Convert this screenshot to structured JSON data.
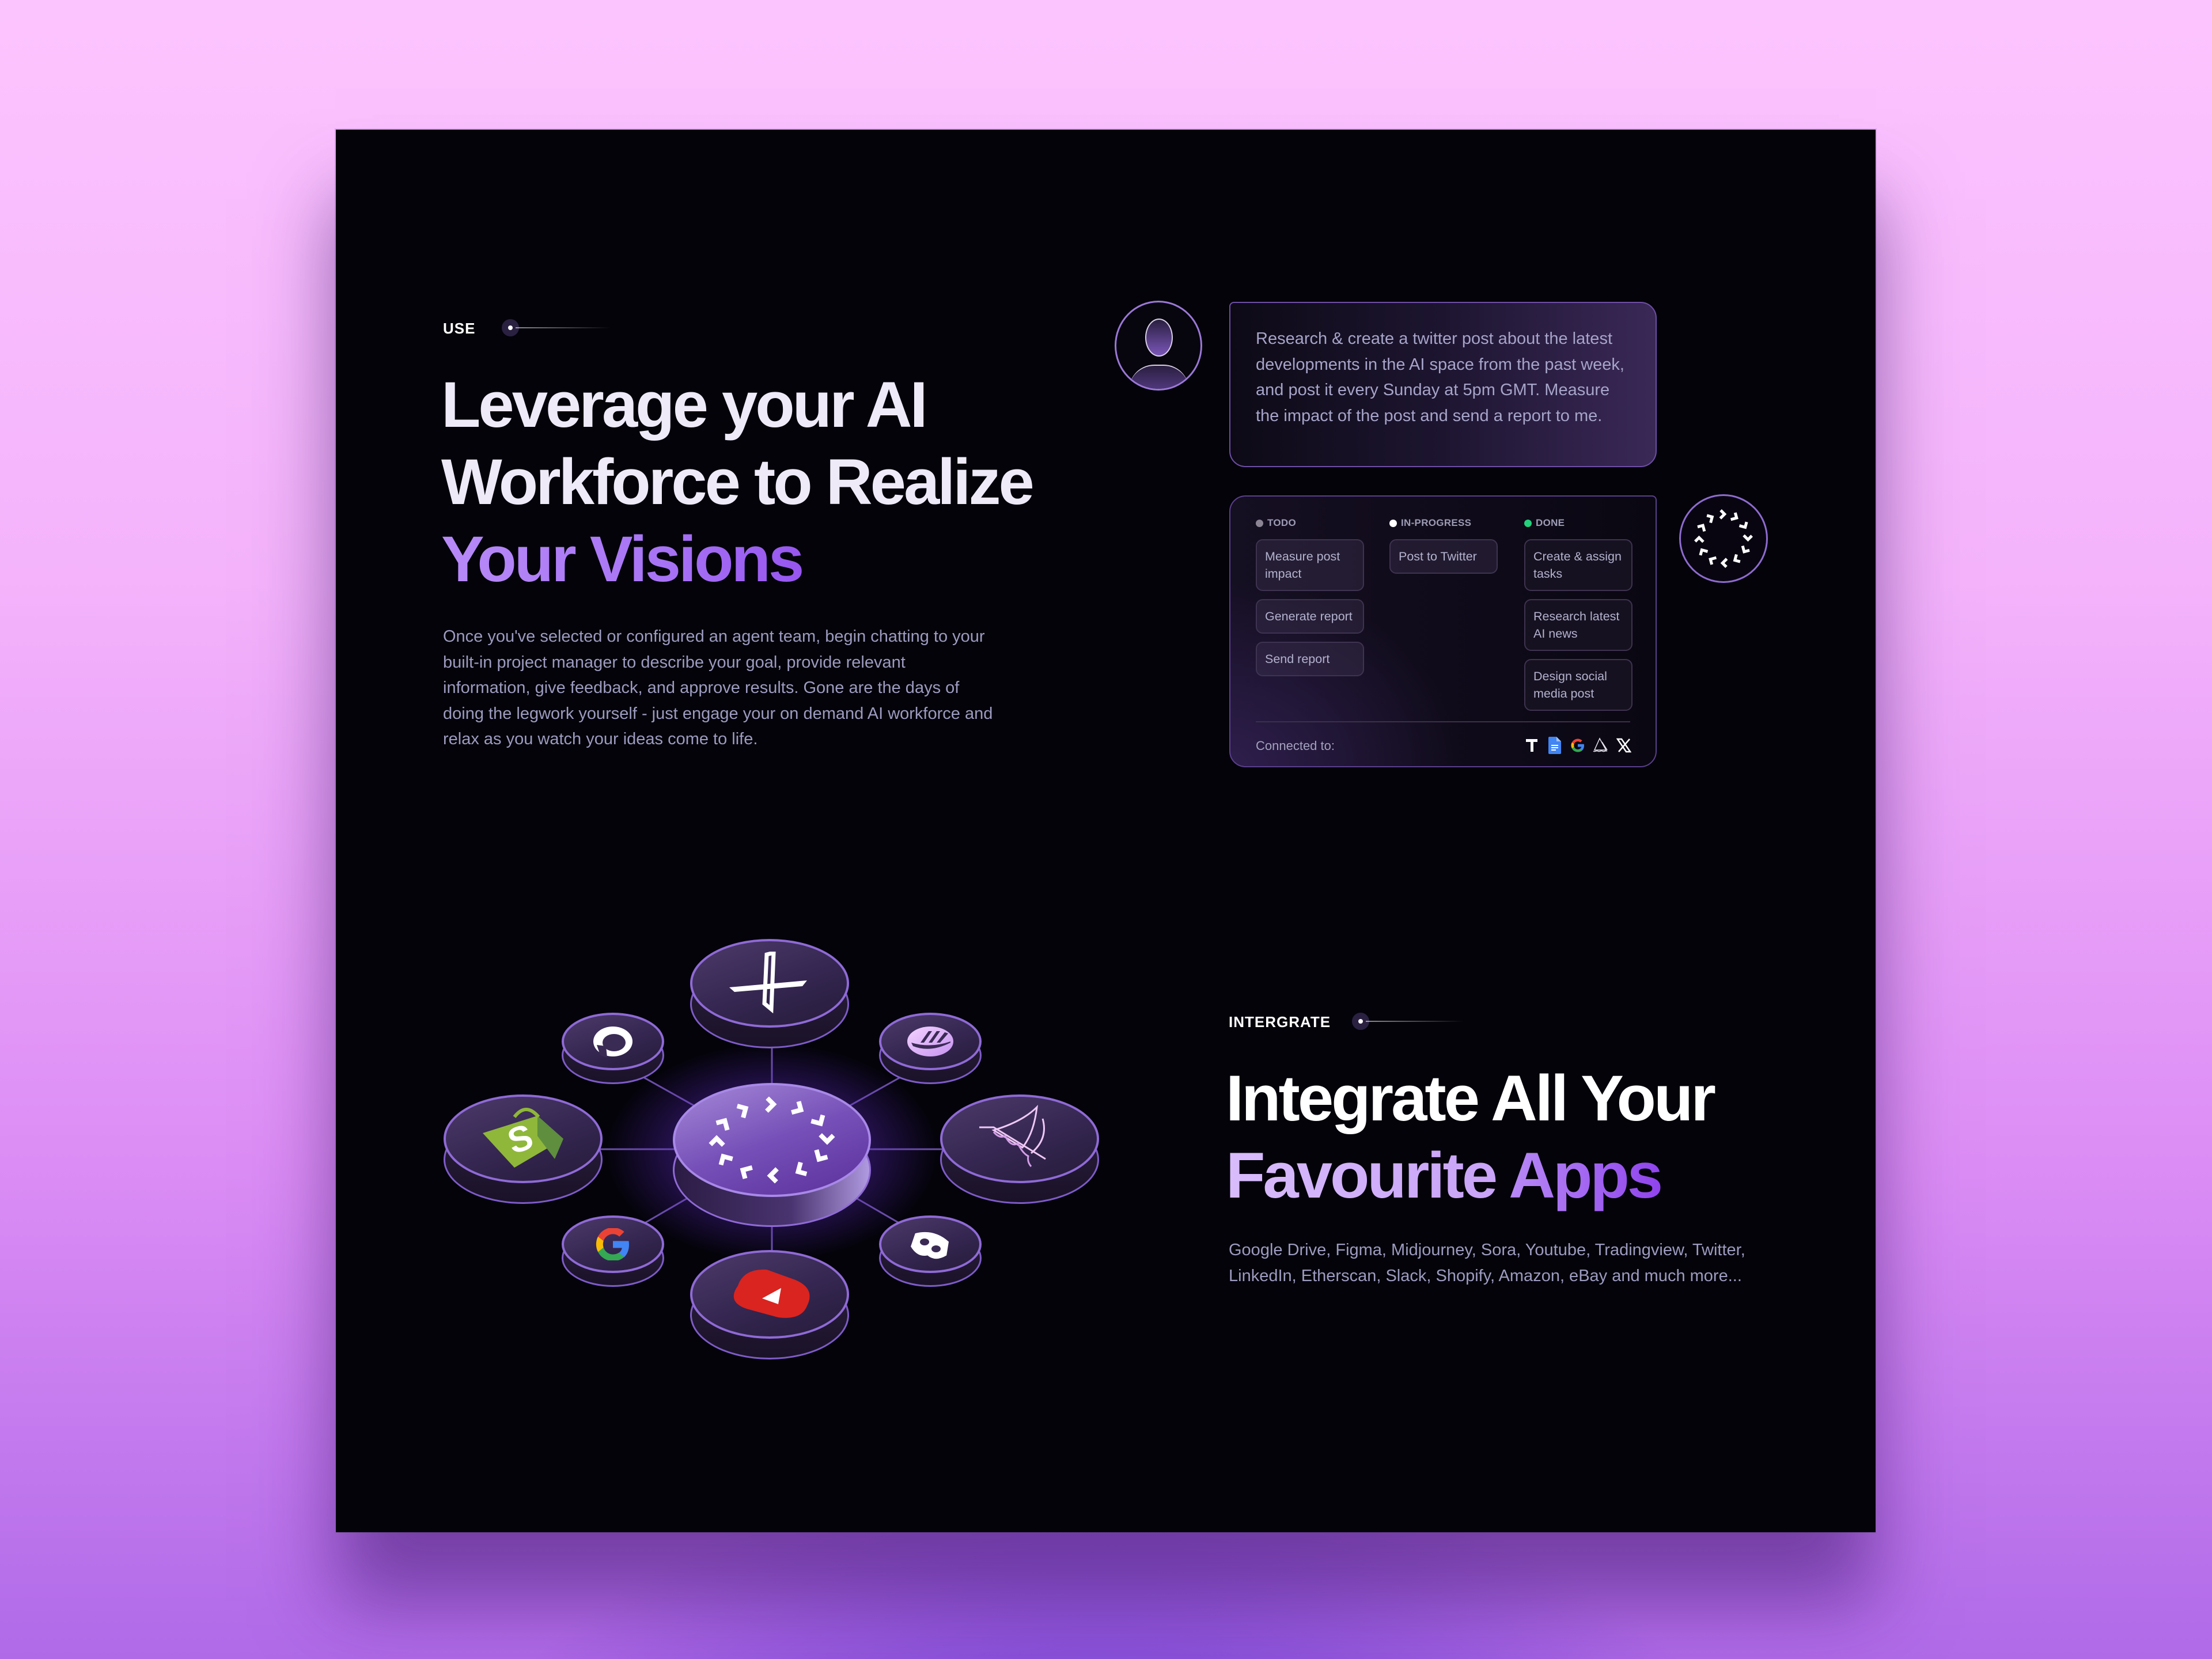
{
  "use_section": {
    "eyebrow": "USE",
    "headline_line1": "Leverage your AI",
    "headline_line2": "Workforce to Realize",
    "headline_accent": "Your Visions",
    "description": "Once you've selected or configured an agent team, begin chatting to your built-in project manager to describe your goal, provide relevant information, give feedback, and approve results. Gone are the days of doing the legwork yourself - just engage your on demand AI workforce and relax as you watch your ideas come to life."
  },
  "chat": {
    "avatar_icon": "user-avatar-icon",
    "message": "Research & create a twitter post about the latest developments in the AI space from the past week, and post it every Sunday at 5pm GMT. Measure the impact of the post and send a report to me."
  },
  "kanban": {
    "columns": [
      {
        "label": "TODO",
        "dot_color": "#8a8494",
        "tasks": [
          "Measure post impact",
          "Generate report",
          "Send report"
        ]
      },
      {
        "label": "IN-PROGRESS",
        "dot_color": "#ffffff",
        "tasks": [
          "Post to Twitter"
        ]
      },
      {
        "label": "DONE",
        "dot_color": "#22d17a",
        "tasks": [
          "Create & assign tasks",
          "Research latest AI news",
          "Design social media post"
        ]
      }
    ],
    "connected_label": "Connected to:",
    "connected_icons": [
      "typefully-icon",
      "google-docs-icon",
      "google-icon",
      "midjourney-icon",
      "x-icon"
    ]
  },
  "agent_loader_icon": "agent-spinner-icon",
  "integrations_diagram": {
    "center_icon": "agent-spinner-icon",
    "apps": [
      "x",
      "github",
      "pocketbase",
      "midjourney",
      "discord",
      "youtube",
      "google",
      "shopify"
    ]
  },
  "integrate_section": {
    "eyebrow": "INTERGRATE",
    "headline_line1": "Integrate All Your",
    "headline_accent_a": "Favourite ",
    "headline_accent_b": "Apps",
    "description_line1": "Google Drive, Figma, Midjourney, Sora, Youtube, Tradingview, Twitter,",
    "description_line2": "LinkedIn, Etherscan, Slack, Shopify, Amazon, eBay and much more..."
  },
  "colors": {
    "accent_purple": "#a874f5",
    "done_green": "#22d17a",
    "frame_bg": "#04030a"
  }
}
